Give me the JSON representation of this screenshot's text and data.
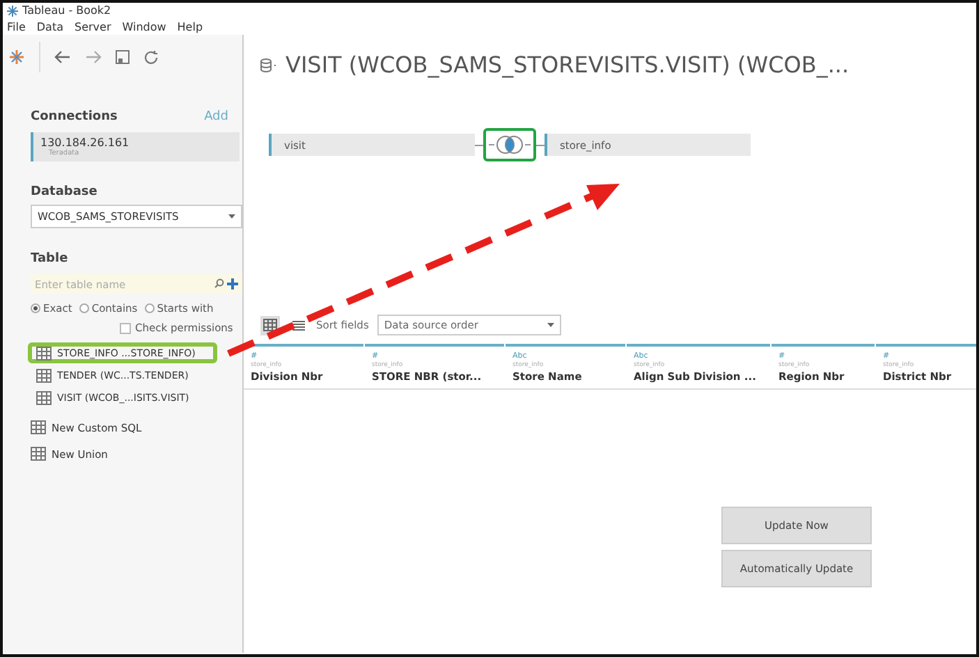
{
  "window": {
    "title": "Tableau - Book2"
  },
  "menu": [
    "File",
    "Data",
    "Server",
    "Window",
    "Help"
  ],
  "connections": {
    "heading": "Connections",
    "add": "Add",
    "items": [
      {
        "host": "130.184.26.161",
        "type": "Teradata",
        "selected": true
      }
    ]
  },
  "database": {
    "label": "Database",
    "value": "WCOB_SAMS_STOREVISITS"
  },
  "table": {
    "label": "Table",
    "placeholder": "Enter table name",
    "match_options": [
      {
        "label": "Exact",
        "selected": true
      },
      {
        "label": "Contains",
        "selected": false
      },
      {
        "label": "Starts with",
        "selected": false
      }
    ],
    "check_permissions": {
      "label": "Check permissions",
      "checked": false
    },
    "items": [
      {
        "label": "STORE_INFO ...STORE_INFO)",
        "highlighted": true
      },
      {
        "label": "TENDER (WC...TS.TENDER)",
        "highlighted": false
      },
      {
        "label": "VISIT (WCOB_...ISITS.VISIT)",
        "highlighted": false
      }
    ],
    "actions": [
      "New Custom SQL",
      "New Union"
    ]
  },
  "main": {
    "title": "VISIT (WCOB_SAMS_STOREVISITS.VISIT) (WCOB_...",
    "join": {
      "left": "visit",
      "right": "store_info",
      "highlighted": true
    },
    "views": [
      {
        "kind": "grid",
        "selected": true
      },
      {
        "kind": "list",
        "selected": false
      }
    ],
    "sort": {
      "label": "Sort fields",
      "value": "Data source order"
    },
    "columns": [
      {
        "type": "#",
        "source": "store_info",
        "name": "Division Nbr"
      },
      {
        "type": "#",
        "source": "store_info",
        "name": "STORE NBR (stor..."
      },
      {
        "type": "Abc",
        "source": "store_info",
        "name": "Store Name"
      },
      {
        "type": "Abc",
        "source": "store_info",
        "name": "Align Sub Division ..."
      },
      {
        "type": "#",
        "source": "store_info",
        "name": "Region Nbr"
      },
      {
        "type": "#",
        "source": "store_info",
        "name": "District Nbr"
      }
    ],
    "buttons": [
      "Update Now",
      "Automatically Update"
    ]
  }
}
